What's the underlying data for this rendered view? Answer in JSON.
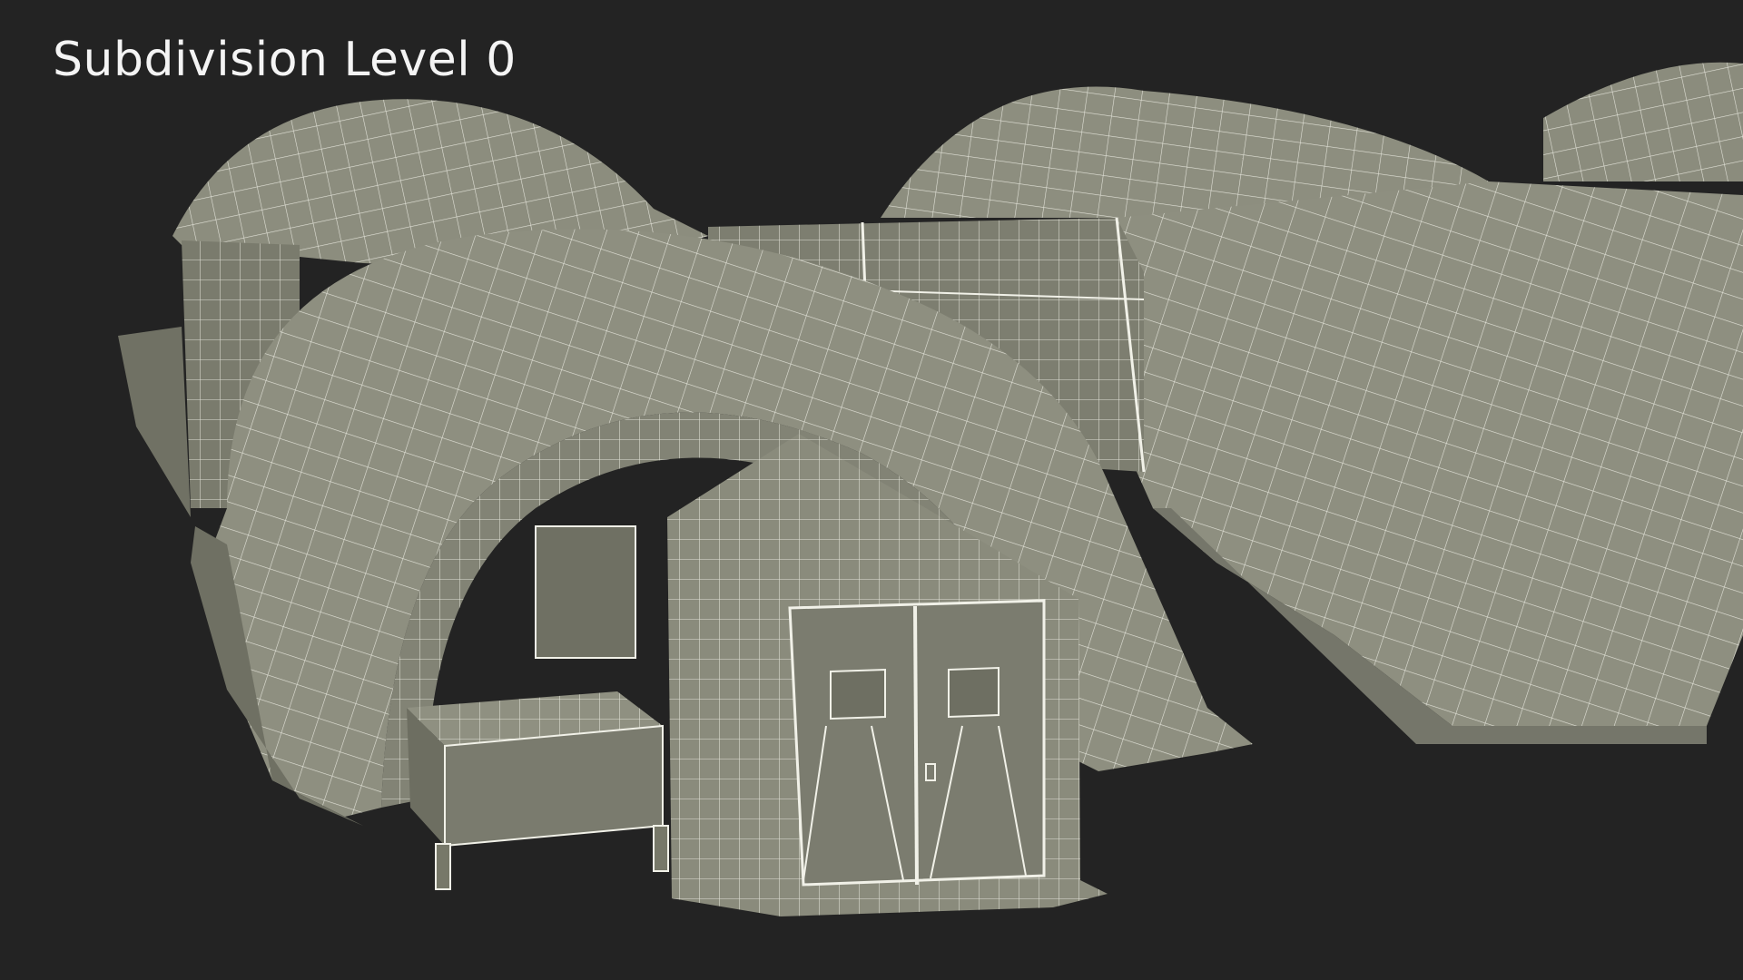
{
  "overlay": {
    "title": "Subdivision Level 0"
  },
  "colors": {
    "background": "#232323",
    "surface": "#8f8f7f",
    "surface_dark": "#77786a",
    "surface_shadow": "#666759",
    "wire": "#f1f1e8"
  }
}
